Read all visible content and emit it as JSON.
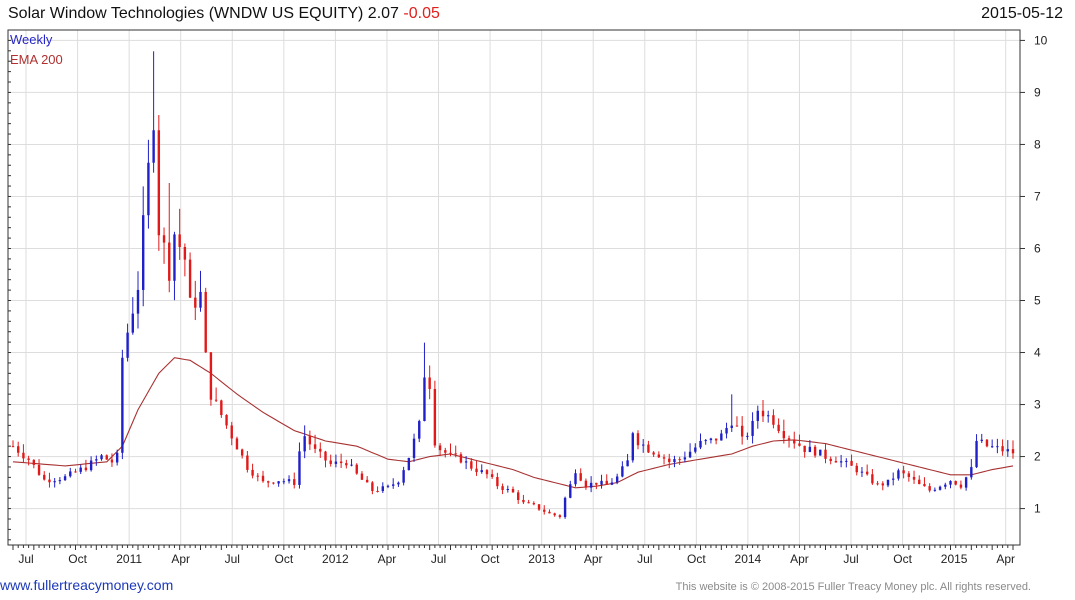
{
  "header": {
    "title": "Solar Window Technologies (WNDW US EQUITY) 2.07",
    "change": "-0.05",
    "date": "2015-05-12"
  },
  "legend": {
    "weekly": "Weekly",
    "ema": "EMA 200"
  },
  "footer": {
    "site": "www.fullertreacymoney.com",
    "copyright": "This website is © 2008-2015 Fuller Treacy Money plc. All rights reserved."
  },
  "colors": {
    "up": "#2020c8",
    "down": "#e01a1a",
    "ema": "#a83232",
    "grid": "#dddddd",
    "axis": "#333333"
  },
  "chart_data": {
    "type": "candlestick",
    "x_ticks": [
      "Jul",
      "Oct",
      "2011",
      "Apr",
      "Jul",
      "Oct",
      "2012",
      "Apr",
      "Jul",
      "Oct",
      "2013",
      "Apr",
      "Jul",
      "Oct",
      "2014",
      "Apr",
      "Jul",
      "Oct",
      "2015",
      "Apr"
    ],
    "y_ticks": [
      1,
      2,
      3,
      4,
      5,
      6,
      7,
      8,
      9,
      10
    ],
    "ylim": [
      0.3,
      10.2
    ],
    "grid": true,
    "series": [
      {
        "name": "Weekly",
        "type": "candlestick",
        "anchors": [
          [
            0,
            2.2
          ],
          [
            3,
            1.95
          ],
          [
            6,
            1.55
          ],
          [
            10,
            1.6
          ],
          [
            14,
            1.8
          ],
          [
            17,
            2.0
          ],
          [
            19,
            1.9
          ],
          [
            20,
            2.0
          ],
          [
            21,
            3.9
          ],
          [
            22,
            4.4
          ],
          [
            24,
            5.3
          ],
          [
            26,
            7.5
          ],
          [
            27,
            8.6
          ],
          [
            28,
            6.4
          ],
          [
            30,
            5.6
          ],
          [
            31,
            6.3
          ],
          [
            33,
            5.8
          ],
          [
            34,
            4.9
          ],
          [
            36,
            5.1
          ],
          [
            37,
            3.9
          ],
          [
            38,
            3.2
          ],
          [
            40,
            2.8
          ],
          [
            42,
            2.4
          ],
          [
            45,
            1.8
          ],
          [
            48,
            1.5
          ],
          [
            51,
            1.55
          ],
          [
            54,
            1.5
          ],
          [
            55,
            2.1
          ],
          [
            56,
            2.4
          ],
          [
            58,
            2.1
          ],
          [
            61,
            1.85
          ],
          [
            64,
            1.9
          ],
          [
            66,
            1.65
          ],
          [
            69,
            1.35
          ],
          [
            72,
            1.4
          ],
          [
            74,
            1.55
          ],
          [
            76,
            2.0
          ],
          [
            78,
            2.6
          ],
          [
            79,
            3.6
          ],
          [
            80,
            3.4
          ],
          [
            81,
            2.3
          ],
          [
            82,
            2.15
          ],
          [
            84,
            2.0
          ],
          [
            86,
            1.95
          ],
          [
            88,
            1.8
          ],
          [
            91,
            1.65
          ],
          [
            93,
            1.45
          ],
          [
            96,
            1.3
          ],
          [
            98,
            1.1
          ],
          [
            100,
            1.05
          ],
          [
            103,
            0.9
          ],
          [
            105,
            0.85
          ],
          [
            106,
            1.2
          ],
          [
            107,
            1.45
          ],
          [
            108,
            1.75
          ],
          [
            110,
            1.45
          ],
          [
            112,
            1.5
          ],
          [
            114,
            1.45
          ],
          [
            116,
            1.6
          ],
          [
            118,
            1.9
          ],
          [
            119,
            2.5
          ],
          [
            120,
            2.3
          ],
          [
            122,
            2.15
          ],
          [
            124,
            2.05
          ],
          [
            126,
            1.9
          ],
          [
            128,
            1.95
          ],
          [
            130,
            2.1
          ],
          [
            132,
            2.25
          ],
          [
            134,
            2.3
          ],
          [
            136,
            2.4
          ],
          [
            138,
            2.7
          ],
          [
            139,
            2.55
          ],
          [
            140,
            2.3
          ],
          [
            142,
            2.6
          ],
          [
            143,
            2.9
          ],
          [
            144,
            2.85
          ],
          [
            146,
            2.7
          ],
          [
            148,
            2.45
          ],
          [
            150,
            2.3
          ],
          [
            152,
            2.15
          ],
          [
            154,
            2.1
          ],
          [
            156,
            2.0
          ],
          [
            158,
            1.95
          ],
          [
            160,
            1.85
          ],
          [
            162,
            1.75
          ],
          [
            164,
            1.6
          ],
          [
            166,
            1.45
          ],
          [
            168,
            1.5
          ],
          [
            170,
            1.7
          ],
          [
            172,
            1.6
          ],
          [
            174,
            1.45
          ],
          [
            176,
            1.35
          ],
          [
            178,
            1.45
          ],
          [
            180,
            1.55
          ],
          [
            182,
            1.45
          ],
          [
            184,
            1.75
          ],
          [
            185,
            2.3
          ],
          [
            187,
            2.2
          ],
          [
            189,
            2.15
          ],
          [
            191,
            2.1
          ],
          [
            192,
            2.08
          ]
        ]
      },
      {
        "name": "EMA 200",
        "type": "line",
        "anchors": [
          [
            0,
            1.9
          ],
          [
            10,
            1.82
          ],
          [
            18,
            1.9
          ],
          [
            21,
            2.2
          ],
          [
            24,
            2.9
          ],
          [
            28,
            3.6
          ],
          [
            31,
            3.9
          ],
          [
            34,
            3.85
          ],
          [
            38,
            3.6
          ],
          [
            43,
            3.2
          ],
          [
            48,
            2.85
          ],
          [
            54,
            2.5
          ],
          [
            60,
            2.3
          ],
          [
            66,
            2.2
          ],
          [
            72,
            1.95
          ],
          [
            76,
            1.9
          ],
          [
            80,
            2.0
          ],
          [
            84,
            2.05
          ],
          [
            90,
            1.9
          ],
          [
            96,
            1.75
          ],
          [
            100,
            1.6
          ],
          [
            104,
            1.5
          ],
          [
            108,
            1.4
          ],
          [
            112,
            1.43
          ],
          [
            116,
            1.5
          ],
          [
            120,
            1.7
          ],
          [
            126,
            1.85
          ],
          [
            132,
            1.95
          ],
          [
            138,
            2.05
          ],
          [
            142,
            2.2
          ],
          [
            146,
            2.3
          ],
          [
            150,
            2.32
          ],
          [
            156,
            2.25
          ],
          [
            162,
            2.1
          ],
          [
            168,
            1.95
          ],
          [
            174,
            1.8
          ],
          [
            180,
            1.65
          ],
          [
            184,
            1.65
          ],
          [
            188,
            1.75
          ],
          [
            192,
            1.82
          ]
        ]
      }
    ]
  }
}
